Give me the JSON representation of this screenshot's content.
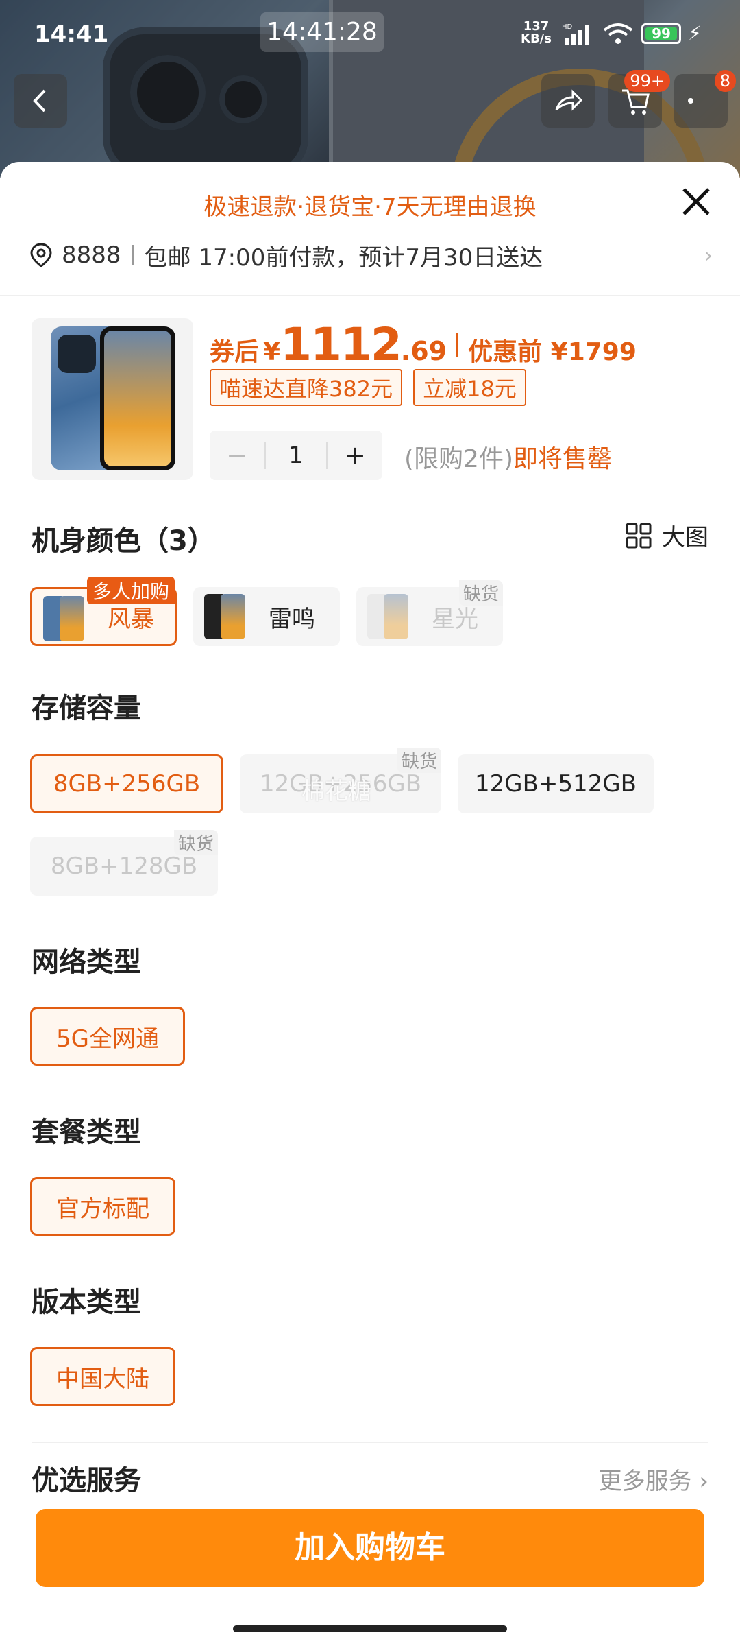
{
  "status_bar": {
    "time": "14:41",
    "center_time": "14:41:28",
    "net_speed_value": "137",
    "net_speed_unit": "KB/s",
    "net_type": "HD",
    "battery": "99"
  },
  "nav": {
    "cart_badge": "99+",
    "msg_badge": "8"
  },
  "sheet": {
    "guarantee": "极速退款·退货宝·7天无理由退换",
    "address": {
      "code": "8888",
      "delivery": "包邮 17:00前付款，预计7月30日送达"
    },
    "product": {
      "price_label": "券后",
      "currency": "¥",
      "price_int": "1112",
      "price_dec": ".69",
      "orig_label": "优惠前 ¥1799",
      "tags": [
        "喵速达直降382元",
        "立减18元"
      ],
      "quantity": "1",
      "minus": "−",
      "plus": "+",
      "limit": "(限购2件)",
      "limit_hot": "即将售罄"
    },
    "color_section": {
      "title": "机身颜色（3）",
      "big_pic": "大图",
      "options": [
        {
          "label": "风暴",
          "badge": "多人加购"
        },
        {
          "label": "雷鸣"
        },
        {
          "label": "星光",
          "badge": "缺货"
        }
      ]
    },
    "storage_section": {
      "title": "存储容量",
      "options": [
        {
          "label": "8GB+256GB"
        },
        {
          "label": "12GB+256GB",
          "badge": "缺货"
        },
        {
          "label": "12GB+512GB"
        },
        {
          "label": "8GB+128GB",
          "badge": "缺货"
        }
      ],
      "watermark": "棉花糖"
    },
    "network_section": {
      "title": "网络类型",
      "options": [
        {
          "label": "5G全网通"
        }
      ]
    },
    "package_section": {
      "title": "套餐类型",
      "options": [
        {
          "label": "官方标配"
        }
      ]
    },
    "version_section": {
      "title": "版本类型",
      "options": [
        {
          "label": "中国大陆"
        }
      ]
    },
    "service_section": {
      "title": "优选服务",
      "more": "更多服务 ›"
    },
    "add_to_cart": "加入购物车"
  },
  "colors": {
    "accent": "#e25d12",
    "button": "#ff8a0c"
  }
}
